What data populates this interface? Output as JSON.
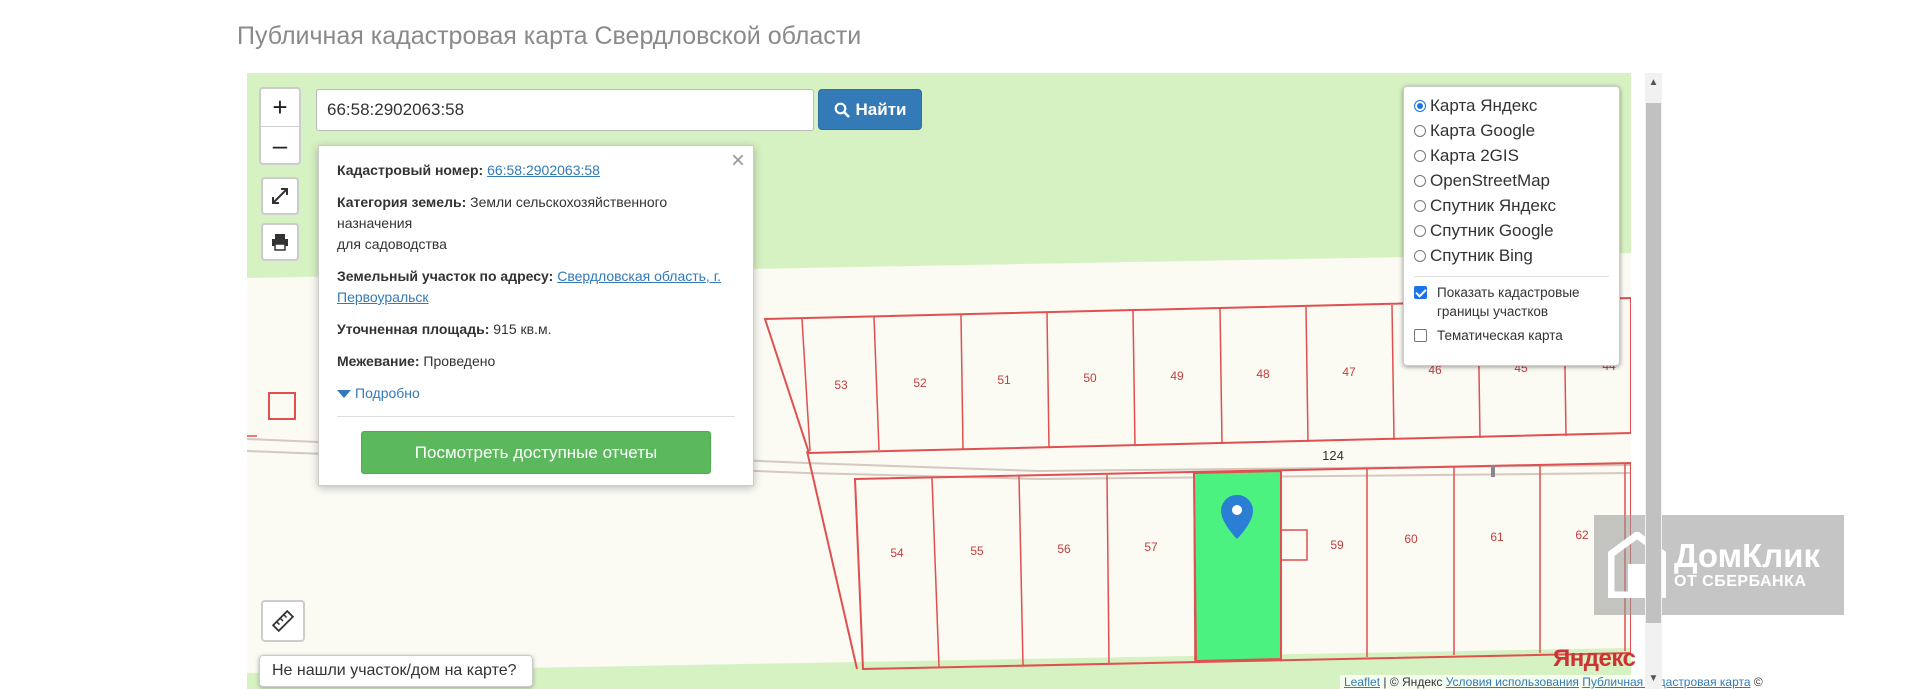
{
  "page": {
    "title": "Публичная кадастровая карта Свердловской области"
  },
  "search": {
    "value": "66:58:2902063:58",
    "button_label": "Найти"
  },
  "zoom": {
    "in_label": "+",
    "out_label": "–"
  },
  "popup": {
    "cadastral_label": "Кадастровый номер:",
    "cadastral_value": "66:58:2902063:58",
    "category_label": "Категория земель:",
    "category_value_1": "Земли сельскохозяйственного назначения",
    "category_value_2": "для садоводства",
    "address_label": "Земельный участок по адресу:",
    "address_value": "Свердловская область, г. Первоуральск",
    "area_label": "Уточненная площадь:",
    "area_value": "915 кв.м.",
    "survey_label": "Межевание:",
    "survey_value": "Проведено",
    "more_label": "Подробно",
    "report_button": "Посмотреть доступные отчеты",
    "close_label": "×"
  },
  "layers": {
    "options": [
      "Карта Яндекс",
      "Карта Google",
      "Карта 2GIS",
      "OpenStreetMap",
      "Спутник Яндекс",
      "Спутник Google",
      "Спутник Bing"
    ],
    "selected": "Карта Яндекс",
    "checkboxes": [
      {
        "label": "Показать кадастровые границы участков",
        "checked": true
      },
      {
        "label": "Тематическая карта",
        "checked": false
      }
    ]
  },
  "map": {
    "top_row_plots": [
      "53",
      "52",
      "51",
      "50",
      "49",
      "48",
      "47",
      "46",
      "45",
      "44"
    ],
    "bottom_row_plots": [
      "54",
      "55",
      "56",
      "57",
      "59",
      "60",
      "61",
      "62"
    ],
    "road_label": "124",
    "provider_logo": "Яндекс",
    "attribution_link1": "Leaflet",
    "attribution_sep": "|",
    "attribution_text": "© Яндекс",
    "attribution_terms": "Условия использования",
    "attribution_link2": "Публичная кадастровая карта",
    "attribution_copy": "©",
    "highlight_color": "#4cf27f",
    "boundary_color": "#e05050"
  },
  "help": {
    "label": "Не нашли участок/дом на карте?"
  },
  "watermark": {
    "brand": "ДомКлик",
    "sub": "ОТ СБЕРБАНКА"
  }
}
